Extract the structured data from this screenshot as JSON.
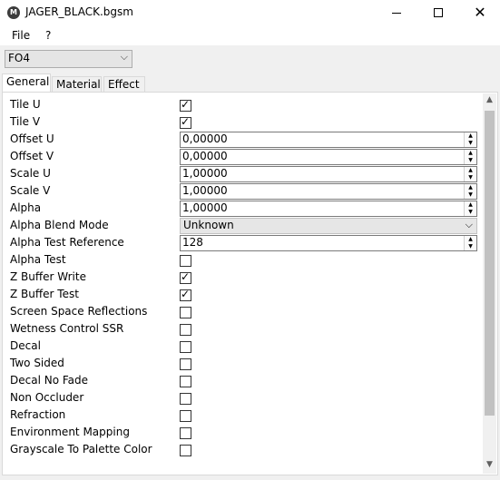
{
  "window": {
    "app_icon": "M",
    "title": "JAGER_BLACK.bgsm",
    "minimize_icon": "minimize-icon",
    "maximize_icon": "maximize-icon",
    "close_glyph": "✕"
  },
  "menu": {
    "file": "File",
    "help": "?"
  },
  "version": {
    "selected": "FO4",
    "chevron": "⌵"
  },
  "tabs": {
    "general": "General",
    "material": "Material",
    "effect": "Effect"
  },
  "glyphs": {
    "check": "✓",
    "spin_up": "▲",
    "spin_down": "▼",
    "combo_chevron": "⌵",
    "scroll_up": "▲",
    "scroll_down": "▼"
  },
  "fields": {
    "tile_u": {
      "label": "Tile U",
      "checked": true
    },
    "tile_v": {
      "label": "Tile V",
      "checked": true
    },
    "offset_u": {
      "label": "Offset U",
      "value": "0,00000"
    },
    "offset_v": {
      "label": "Offset V",
      "value": "0,00000"
    },
    "scale_u": {
      "label": "Scale U",
      "value": "1,00000"
    },
    "scale_v": {
      "label": "Scale V",
      "value": "1,00000"
    },
    "alpha": {
      "label": "Alpha",
      "value": "1,00000"
    },
    "alpha_blend_mode": {
      "label": "Alpha Blend Mode",
      "value": "Unknown"
    },
    "alpha_test_reference": {
      "label": "Alpha Test Reference",
      "value": "128"
    },
    "alpha_test": {
      "label": "Alpha Test",
      "checked": false
    },
    "z_buffer_write": {
      "label": "Z Buffer Write",
      "checked": true
    },
    "z_buffer_test": {
      "label": "Z Buffer Test",
      "checked": true
    },
    "screen_space_reflections": {
      "label": "Screen Space Reflections",
      "checked": false
    },
    "wetness_control_ssr": {
      "label": "Wetness Control SSR",
      "checked": false
    },
    "decal": {
      "label": "Decal",
      "checked": false
    },
    "two_sided": {
      "label": "Two Sided",
      "checked": false
    },
    "decal_no_fade": {
      "label": "Decal No Fade",
      "checked": false
    },
    "non_occluder": {
      "label": "Non Occluder",
      "checked": false
    },
    "refraction": {
      "label": "Refraction",
      "checked": false
    },
    "environment_mapping": {
      "label": "Environment Mapping",
      "checked": false
    },
    "grayscale_to_palette_color": {
      "label": "Grayscale To Palette Color",
      "checked": false
    }
  }
}
